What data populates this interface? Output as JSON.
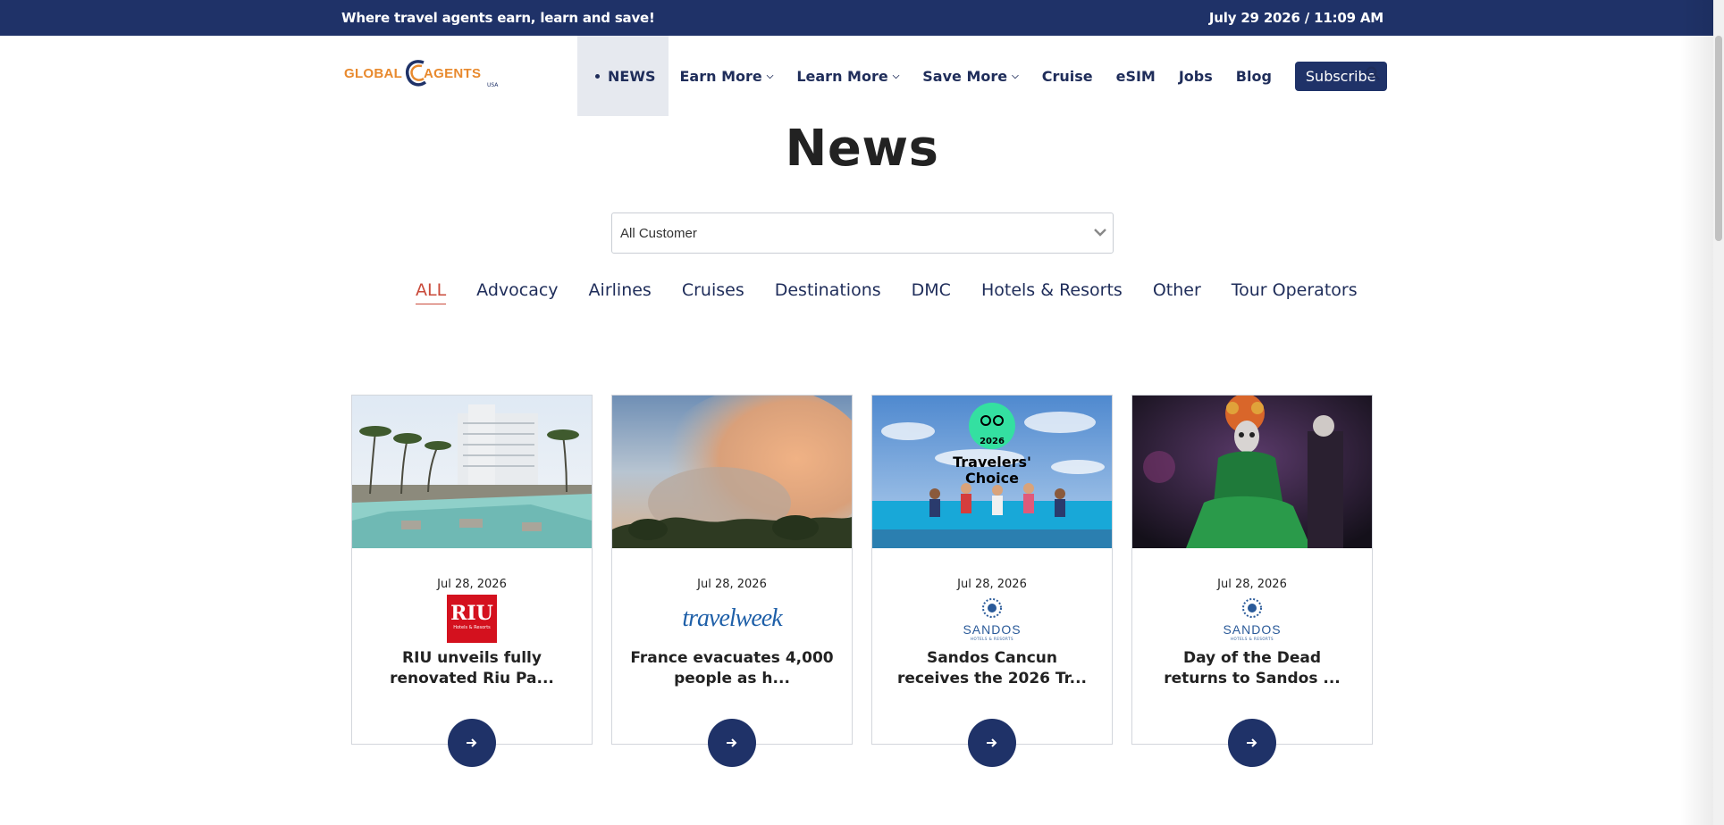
{
  "topbar": {
    "tagline": "Where travel agents earn, learn and save!",
    "datetime": "July 29 2026 / 11:09 AM"
  },
  "logo": {
    "left_text": "GLOBAL",
    "right_text": "AGENTS",
    "suffix": "USA"
  },
  "nav": {
    "items": [
      {
        "label": "NEWS",
        "active": true
      },
      {
        "label": "Earn More",
        "dropdown": true
      },
      {
        "label": "Learn More",
        "dropdown": true
      },
      {
        "label": "Save More",
        "dropdown": true
      },
      {
        "label": "Cruise"
      },
      {
        "label": "eSIM"
      },
      {
        "label": "Jobs"
      },
      {
        "label": "Blog"
      }
    ],
    "subscribe_label": "Subscribe"
  },
  "page": {
    "title": "News"
  },
  "filter_select": {
    "value": "All Customer"
  },
  "category_filters": [
    {
      "label": "ALL",
      "active": true
    },
    {
      "label": "Advocacy"
    },
    {
      "label": "Airlines"
    },
    {
      "label": "Cruises"
    },
    {
      "label": "Destinations"
    },
    {
      "label": "DMC"
    },
    {
      "label": "Hotels & Resorts"
    },
    {
      "label": "Other"
    },
    {
      "label": "Tour Operators"
    }
  ],
  "cards": [
    {
      "date": "Jul 28, 2026",
      "source_logo": "riu-logo",
      "source_text": "RIU",
      "source_subtext": "Hotels & Resorts",
      "title": "RIU unveils fully renovated Riu Pa..."
    },
    {
      "date": "Jul 28, 2026",
      "source_logo": "travelweek-logo",
      "source_text": "travelweek",
      "title": "France evacuates 4,000 people as h..."
    },
    {
      "date": "Jul 28, 2026",
      "source_logo": "sandos-logo",
      "source_text": "SANDOS",
      "source_subtext": "HOTELS & RESORTS",
      "image_overlay_text": [
        "2026",
        "Travelers'",
        "Choice"
      ],
      "title": "Sandos Cancun receives the 2026 Tr..."
    },
    {
      "date": "Jul 28, 2026",
      "source_logo": "sandos-logo",
      "source_text": "SANDOS",
      "source_subtext": "HOTELS & RESORTS",
      "title": "Day of the Dead returns to Sandos ..."
    }
  ],
  "colors": {
    "brand_navy": "#1f3268",
    "brand_orange": "#e8892d",
    "active_filter": "#c94a3a"
  }
}
